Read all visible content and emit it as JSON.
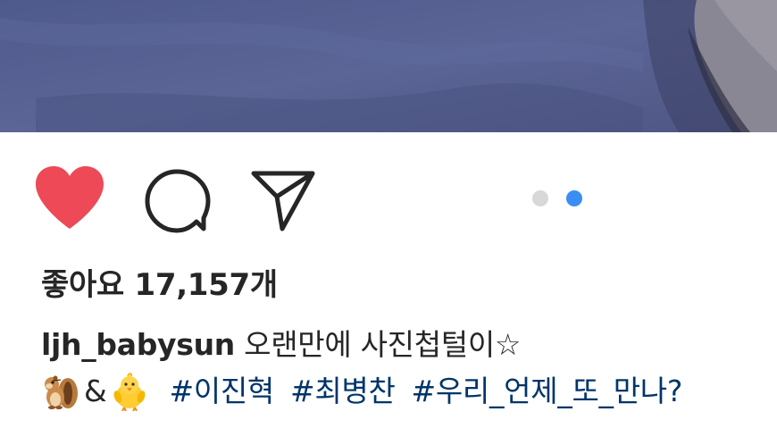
{
  "post": {
    "likes_label": "좋아요 17,157개",
    "username": "ljh_babysun",
    "caption_text": "오랜만에 사진첩털이☆",
    "emoji_1": "chipmunk-emoji",
    "connector": "&",
    "emoji_2": "baby-chick-emoji",
    "hashtags": [
      "#이진혁",
      "#최병찬",
      "#우리_언제_또_만나?"
    ]
  },
  "icons": {
    "like": "heart-icon",
    "comment": "comment-bubble-icon",
    "share": "paper-plane-icon"
  },
  "carousel": {
    "total": 2,
    "active_index": 2
  },
  "colors": {
    "like_red": "#ed4956",
    "dot_active": "#3a8ef3",
    "dot_inactive": "#d8d8d8",
    "hashtag": "#003569",
    "text": "#262626"
  }
}
